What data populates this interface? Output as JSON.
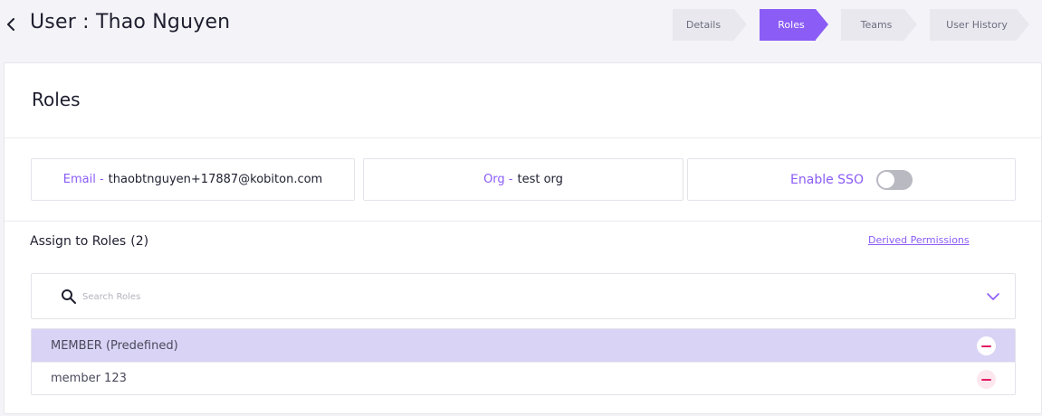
{
  "header": {
    "title": "User : Thao Nguyen",
    "steps": [
      {
        "label": "Details",
        "active": false
      },
      {
        "label": "Roles",
        "active": true
      },
      {
        "label": "Teams",
        "active": false
      },
      {
        "label": "User History",
        "active": false
      }
    ]
  },
  "card": {
    "title": "Roles",
    "email": {
      "label": "Email -",
      "value": "thaobtnguyen+17887@kobiton.com"
    },
    "org": {
      "label": "Org -",
      "value": "test org"
    },
    "sso": {
      "label": "Enable SSO",
      "enabled": false
    }
  },
  "assign": {
    "title": "Assign to Roles",
    "count": "(2)",
    "derived_link": "Derived Permissions",
    "search_placeholder": "Search Roles",
    "roles": [
      {
        "name": "MEMBER (Predefined)",
        "selected": true
      },
      {
        "name": "member 123",
        "selected": false
      }
    ]
  },
  "colors": {
    "accent": "#8b5cf6",
    "selected_row": "#d9d3f5",
    "remove": "#e11d63"
  }
}
